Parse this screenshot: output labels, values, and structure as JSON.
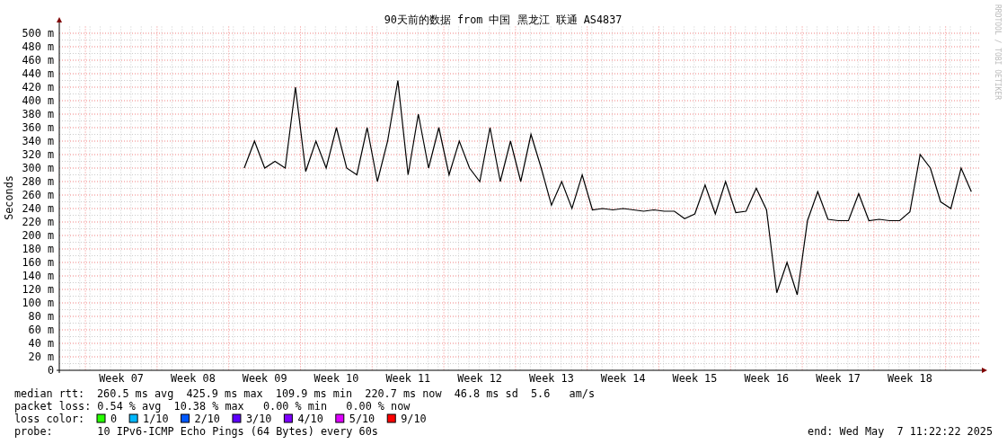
{
  "title": "90天前的数据 from 中国 黑龙江 联通 AS4837",
  "credit": "RRDTOOL / TOBI OETIKER",
  "chart_data": {
    "type": "line",
    "grid": true,
    "ylabel": "Seconds",
    "ylim": [
      0,
      510
    ],
    "categories": [
      null,
      null,
      null,
      null,
      null,
      null,
      "Week 07",
      null,
      null,
      null,
      null,
      null,
      null,
      "Week 08",
      null,
      null,
      null,
      null,
      null,
      null,
      "Week 09",
      null,
      null,
      null,
      null,
      null,
      null,
      "Week 10",
      null,
      null,
      null,
      null,
      null,
      null,
      "Week 11",
      null,
      null,
      null,
      null,
      null,
      null,
      "Week 12",
      null,
      null,
      null,
      null,
      null,
      null,
      "Week 13",
      null,
      null,
      null,
      null,
      null,
      null,
      "Week 14",
      null,
      null,
      null,
      null,
      null,
      null,
      "Week 15",
      null,
      null,
      null,
      null,
      null,
      null,
      "Week 16",
      null,
      null,
      null,
      null,
      null,
      null,
      "Week 17",
      null,
      null,
      null,
      null,
      null,
      null,
      "Week 18",
      null,
      null,
      null,
      null,
      null,
      null
    ],
    "series": [
      {
        "name": "median rtt:",
        "color": "#000000",
        "values": [
          null,
          null,
          null,
          null,
          null,
          null,
          null,
          null,
          null,
          null,
          null,
          null,
          null,
          null,
          null,
          null,
          null,
          null,
          300,
          340,
          300,
          310,
          300,
          420,
          295,
          340,
          300,
          360,
          300,
          290,
          360,
          280,
          340,
          430,
          290,
          380,
          300,
          360,
          290,
          340,
          300,
          280,
          360,
          280,
          340,
          280,
          350,
          300,
          245,
          280,
          240,
          290,
          238,
          240,
          238,
          240,
          238,
          236,
          238,
          236,
          236,
          225,
          232,
          275,
          232,
          280,
          234,
          236,
          270,
          238,
          115,
          160,
          112,
          222,
          265,
          224,
          222,
          222,
          262,
          222,
          224,
          222,
          222,
          235,
          320,
          300,
          250,
          240,
          300,
          265
        ]
      }
    ],
    "yticks": [
      {
        "value": 0,
        "label": "0"
      },
      {
        "value": 20,
        "label": "20 m"
      },
      {
        "value": 40,
        "label": "40 m"
      },
      {
        "value": 60,
        "label": "60 m"
      },
      {
        "value": 80,
        "label": "80 m"
      },
      {
        "value": 100,
        "label": "100 m"
      },
      {
        "value": 120,
        "label": "120 m"
      },
      {
        "value": 140,
        "label": "140 m"
      },
      {
        "value": 160,
        "label": "160 m"
      },
      {
        "value": 180,
        "label": "180 m"
      },
      {
        "value": 200,
        "label": "200 m"
      },
      {
        "value": 220,
        "label": "220 m"
      },
      {
        "value": 240,
        "label": "240 m"
      },
      {
        "value": 260,
        "label": "260 m"
      },
      {
        "value": 280,
        "label": "280 m"
      },
      {
        "value": 300,
        "label": "300 m"
      },
      {
        "value": 320,
        "label": "320 m"
      },
      {
        "value": 340,
        "label": "340 m"
      },
      {
        "value": 360,
        "label": "360 m"
      },
      {
        "value": 380,
        "label": "380 m"
      },
      {
        "value": 400,
        "label": "400 m"
      },
      {
        "value": 420,
        "label": "420 m"
      },
      {
        "value": 440,
        "label": "440 m"
      },
      {
        "value": 460,
        "label": "460 m"
      },
      {
        "value": 480,
        "label": "480 m"
      },
      {
        "value": 500,
        "label": "500 m"
      }
    ]
  },
  "median_rtt": "260.5 ms avg  425.9 ms max  109.9 ms min  220.7 ms now  46.8 ms sd  5.6   am/s",
  "packet_loss": "packet loss: 0.54 % avg  10.38 % max   0.00 % min   0.00 % now",
  "loss_color": {
    "label": "loss color:",
    "items": [
      {
        "label": "0",
        "color": "#26ff00"
      },
      {
        "label": "1/10",
        "color": "#00b8ff"
      },
      {
        "label": "2/10",
        "color": "#0059ff"
      },
      {
        "label": "3/10",
        "color": "#5e00ff"
      },
      {
        "label": "4/10",
        "color": "#7e00ff"
      },
      {
        "label": "5/10",
        "color": "#dd00ff"
      },
      {
        "label": "9/10",
        "color": "#ff0000"
      }
    ]
  },
  "probe": "probe:       10 IPv6-ICMP Echo Pings (64 Bytes) every 60s",
  "end": "end: Wed May  7 11:22:22 2025"
}
